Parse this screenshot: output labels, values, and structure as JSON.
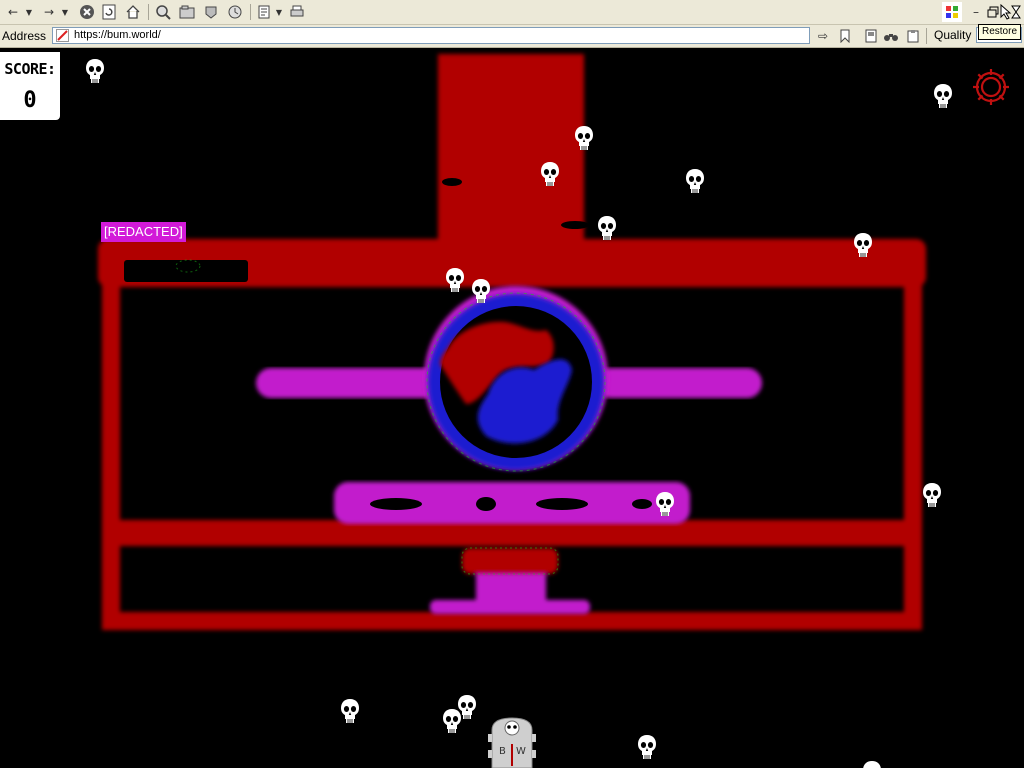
{
  "browser": {
    "address_label": "Address",
    "url": "https://bum.world/",
    "quality_label": "Quality",
    "tooltip": "Restore"
  },
  "hud": {
    "score_label": "SCORE:",
    "score_value": "0"
  },
  "player": {
    "name_tag": "[REDACTED]"
  },
  "tower": {
    "letters": [
      "B",
      "W"
    ]
  },
  "colors": {
    "level_red": "#b10000",
    "level_magenta": "#c21acc",
    "orb_blue": "#1a1ad0",
    "tag_magenta": "#d21ad8",
    "gear_red": "#c01010"
  },
  "skulls": [
    {
      "id": "skull-1"
    },
    {
      "id": "skull-2"
    },
    {
      "id": "skull-3"
    },
    {
      "id": "skull-4"
    },
    {
      "id": "skull-5"
    },
    {
      "id": "skull-6"
    },
    {
      "id": "skull-7"
    },
    {
      "id": "skull-8"
    },
    {
      "id": "skull-9"
    },
    {
      "id": "skull-10"
    },
    {
      "id": "skull-11"
    },
    {
      "id": "skull-12"
    },
    {
      "id": "skull-13"
    },
    {
      "id": "skull-14"
    },
    {
      "id": "skull-15"
    },
    {
      "id": "skull-16"
    }
  ]
}
